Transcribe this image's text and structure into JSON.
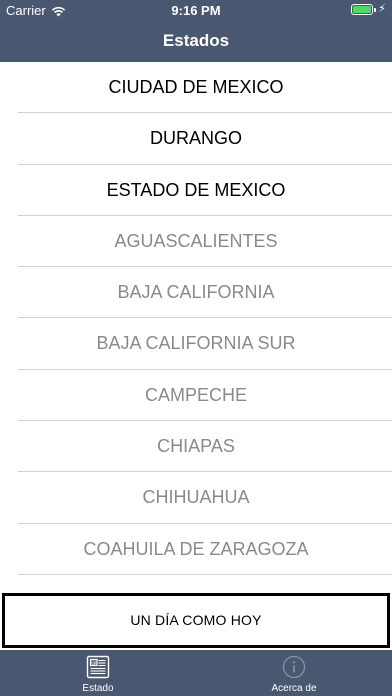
{
  "status_bar": {
    "carrier": "Carrier",
    "time": "9:16 PM",
    "battery_icon": "battery-full-icon",
    "battery_color": "#4cd964"
  },
  "nav": {
    "title": "Estados"
  },
  "states": [
    {
      "label": "CIUDAD DE MEXICO",
      "enabled": true
    },
    {
      "label": "DURANGO",
      "enabled": true
    },
    {
      "label": "ESTADO DE MEXICO",
      "enabled": true
    },
    {
      "label": "AGUASCALIENTES",
      "enabled": false
    },
    {
      "label": "BAJA CALIFORNIA",
      "enabled": false
    },
    {
      "label": "BAJA CALIFORNIA SUR",
      "enabled": false
    },
    {
      "label": "CAMPECHE",
      "enabled": false
    },
    {
      "label": "CHIAPAS",
      "enabled": false
    },
    {
      "label": "CHIHUAHUA",
      "enabled": false
    },
    {
      "label": "COAHUILA DE ZARAGOZA",
      "enabled": false
    }
  ],
  "promo": {
    "label": "UN DÍA COMO HOY"
  },
  "tabbar": {
    "tabs": [
      {
        "label": "Estado",
        "icon": "news-icon",
        "selected": true
      },
      {
        "label": "Acerca de",
        "icon": "info-icon",
        "selected": false
      }
    ]
  },
  "colors": {
    "bar_background": "#4a5770",
    "enabled_text": "#000000",
    "disabled_text": "#8a8a8e",
    "separator": "#d2d2d6"
  }
}
